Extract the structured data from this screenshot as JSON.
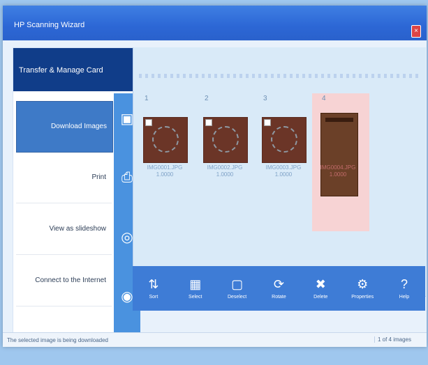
{
  "window": {
    "title": "HP Scanning Wizard"
  },
  "sidebar": {
    "header": "Transfer & Manage Card",
    "tasks": [
      {
        "label": "Download Images"
      },
      {
        "label": "Print"
      },
      {
        "label": "View as slideshow"
      },
      {
        "label": "Connect to the Internet"
      }
    ]
  },
  "thumbnails": [
    {
      "num": "1",
      "caption": "IMG0001.JPG\n1.0000"
    },
    {
      "num": "2",
      "caption": "IMG0002.JPG\n1.0000"
    },
    {
      "num": "3",
      "caption": "IMG0003.JPG\n1.0000"
    },
    {
      "num": "4",
      "caption": "IMG0004.JPG\n1.0000"
    }
  ],
  "toolbar": [
    {
      "label": "Sort"
    },
    {
      "label": "Select"
    },
    {
      "label": "Deselect"
    },
    {
      "label": "Rotate"
    },
    {
      "label": "Delete"
    },
    {
      "label": "Properties"
    },
    {
      "label": "Help"
    }
  ],
  "statusbar": {
    "left": "The selected image is being downloaded",
    "right": "1 of 4 images"
  }
}
